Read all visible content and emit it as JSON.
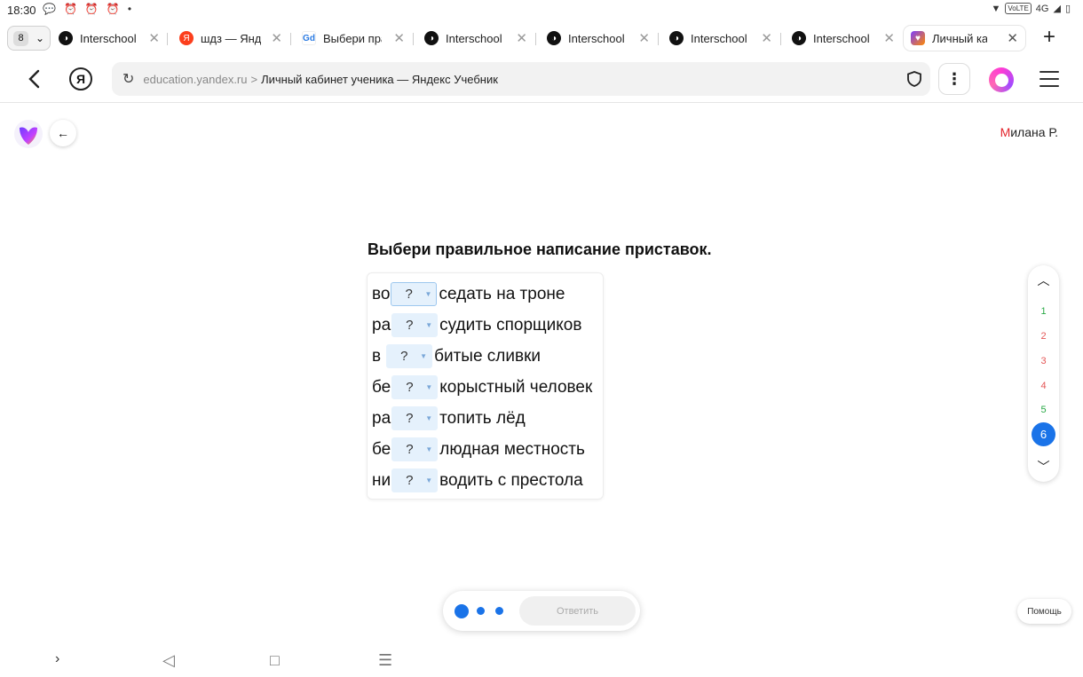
{
  "status_bar": {
    "time": "18:30",
    "volte": "VoLTE",
    "network": "4G",
    "notification_icons": [
      "chat-bubble-icon",
      "alarm-icon",
      "alarm-icon",
      "alarm-icon",
      "dot-icon"
    ]
  },
  "tabs": {
    "count": "8",
    "items": [
      {
        "title": "Interschool",
        "favicon": "interschool-icon"
      },
      {
        "title": "шдз — Яндекс",
        "favicon": "yandex-icon"
      },
      {
        "title": "Выбери правильное",
        "favicon": "gdz-icon"
      },
      {
        "title": "Interschool",
        "favicon": "interschool-icon"
      },
      {
        "title": "Interschool",
        "favicon": "interschool-icon"
      },
      {
        "title": "Interschool",
        "favicon": "interschool-icon"
      },
      {
        "title": "Interschool",
        "favicon": "interschool-icon"
      },
      {
        "title": "Личный кабинет",
        "favicon": "yandex-uchebnik-icon",
        "active": true
      }
    ]
  },
  "address_bar": {
    "host": "education.yandex.ru",
    "separator": ">",
    "page_title": "Личный кабинет ученика — Яндекс Учебник",
    "ya_letter": "Я"
  },
  "header": {
    "user_first_letter": "М",
    "user_rest": "илана Р."
  },
  "task": {
    "title": "Выбери правильное написание приставок.",
    "placeholder": "?",
    "rows": [
      {
        "prefix": "во",
        "suffix": "седать на троне"
      },
      {
        "prefix": "ра",
        "suffix": "судить спорщиков"
      },
      {
        "prefix": "в",
        "suffix": "битые сливки"
      },
      {
        "prefix": "бе",
        "suffix": "корыстный человек"
      },
      {
        "prefix": "ра",
        "suffix": "топить лёд"
      },
      {
        "prefix": "бе",
        "suffix": "людная местность"
      },
      {
        "prefix": "ни",
        "suffix": "водить с престола"
      }
    ]
  },
  "question_nav": {
    "items": [
      {
        "label": "1",
        "status": "ok"
      },
      {
        "label": "2",
        "status": "err"
      },
      {
        "label": "3",
        "status": "err"
      },
      {
        "label": "4",
        "status": "err"
      },
      {
        "label": "5",
        "status": "ok"
      },
      {
        "label": "6",
        "status": "current"
      }
    ]
  },
  "answer_bar": {
    "answer_label": "Ответить"
  },
  "help": {
    "label": "Помощь"
  },
  "colors": {
    "accent": "#1a73e8",
    "ok": "#27a844",
    "error": "#e45757",
    "select_bg": "#e5f1fc",
    "user_accent": "#e3242b"
  }
}
